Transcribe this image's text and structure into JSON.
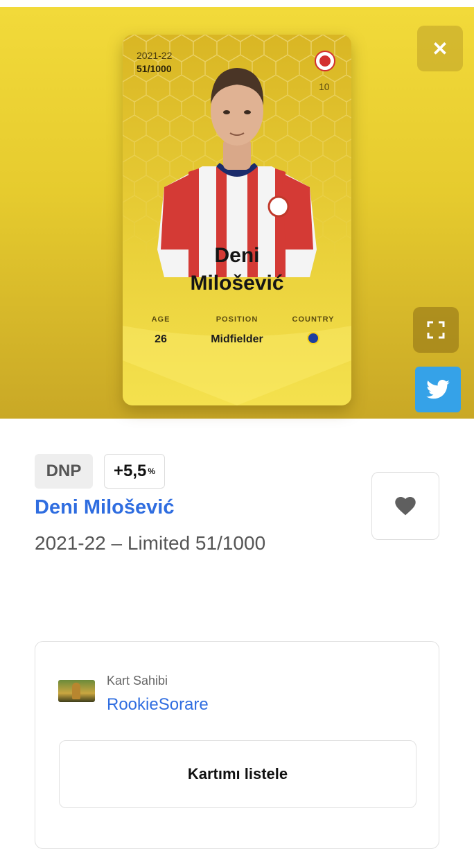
{
  "card": {
    "season": "2021-22",
    "serial": "51/1000",
    "shirt_number": "10",
    "first_name": "Deni",
    "last_name": "Milošević",
    "stats": [
      {
        "label": "AGE",
        "value": "26"
      },
      {
        "label": "POSITION",
        "value": "Midfielder"
      },
      {
        "label": "COUNTRY",
        "value": ""
      }
    ],
    "colors": {
      "gold": "#e9cf38",
      "shirt_red": "#d32f2f"
    }
  },
  "hero_actions": {
    "close_icon": "close-icon",
    "expand_icon": "fullscreen-icon",
    "share_icon": "twitter-icon"
  },
  "details": {
    "status_tag": "DNP",
    "bonus_value": "+5,5",
    "bonus_unit": "%",
    "player_name": "Deni Milošević",
    "edition": "2021-22 – Limited 51/1000",
    "favorite_icon": "heart-icon"
  },
  "owner": {
    "label": "Kart Sahibi",
    "username": "RookieSorare",
    "list_button": "Kartımı listele"
  }
}
